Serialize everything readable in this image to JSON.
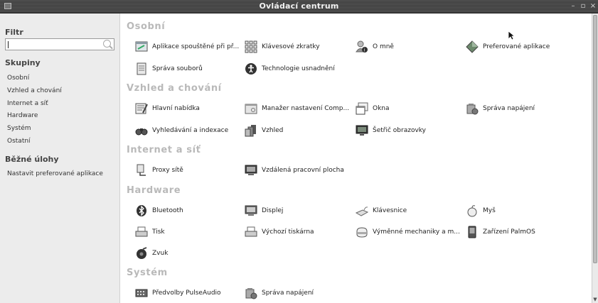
{
  "window": {
    "title": "Ovládací centrum",
    "controls": [
      "–",
      "▫",
      "×"
    ]
  },
  "sidebar": {
    "filter_label": "Filtr",
    "search_value": "",
    "groups_label": "Skupiny",
    "groups": [
      "Osobní",
      "Vzhled a chování",
      "Internet a síť",
      "Hardware",
      "Systém",
      "Ostatní"
    ],
    "tasks_label": "Běžné úlohy",
    "tasks": [
      "Nastavit preferované aplikace"
    ]
  },
  "sections": [
    {
      "title": "Osobní",
      "items": [
        {
          "label": "Aplikace spouštěné při př...",
          "icon": "startup-icon"
        },
        {
          "label": "Klávesové zkratky",
          "icon": "keyboard-shortcuts-icon"
        },
        {
          "label": "O mně",
          "icon": "about-me-icon"
        },
        {
          "label": "Preferované aplikace",
          "icon": "preferred-apps-icon"
        },
        {
          "label": "Správa souborů",
          "icon": "file-management-icon"
        },
        {
          "label": "Technologie usnadnění",
          "icon": "accessibility-icon"
        }
      ]
    },
    {
      "title": "Vzhled a chování",
      "items": [
        {
          "label": "Hlavní nabídka",
          "icon": "main-menu-icon"
        },
        {
          "label": "Manažer nastavení Comp...",
          "icon": "compiz-settings-icon"
        },
        {
          "label": "Okna",
          "icon": "windows-icon"
        },
        {
          "label": "Správa napájení",
          "icon": "power-management-icon"
        },
        {
          "label": "Vyhledávání a indexace",
          "icon": "search-indexing-icon"
        },
        {
          "label": "Vzhled",
          "icon": "appearance-icon"
        },
        {
          "label": "Šetřič obrazovky",
          "icon": "screensaver-icon"
        }
      ]
    },
    {
      "title": "Internet a síť",
      "items": [
        {
          "label": "Proxy sítě",
          "icon": "network-proxy-icon"
        },
        {
          "label": "Vzdálená pracovní plocha",
          "icon": "remote-desktop-icon"
        }
      ]
    },
    {
      "title": "Hardware",
      "items": [
        {
          "label": "Bluetooth",
          "icon": "bluetooth-icon"
        },
        {
          "label": "Displej",
          "icon": "display-icon"
        },
        {
          "label": "Klávesnice",
          "icon": "keyboard-icon"
        },
        {
          "label": "Myš",
          "icon": "mouse-icon"
        },
        {
          "label": "Tisk",
          "icon": "printer-icon"
        },
        {
          "label": "Výchozí tiskárna",
          "icon": "default-printer-icon"
        },
        {
          "label": "Výměnné mechaniky a m...",
          "icon": "removable-drives-icon"
        },
        {
          "label": "Zařízení PalmOS",
          "icon": "palmos-device-icon"
        },
        {
          "label": "Zvuk",
          "icon": "sound-icon"
        }
      ]
    },
    {
      "title": "Systém",
      "items": [
        {
          "label": "Předvolby PulseAudio",
          "icon": "pulseaudio-icon"
        },
        {
          "label": "Správa napájení",
          "icon": "power-management-icon"
        }
      ]
    }
  ]
}
